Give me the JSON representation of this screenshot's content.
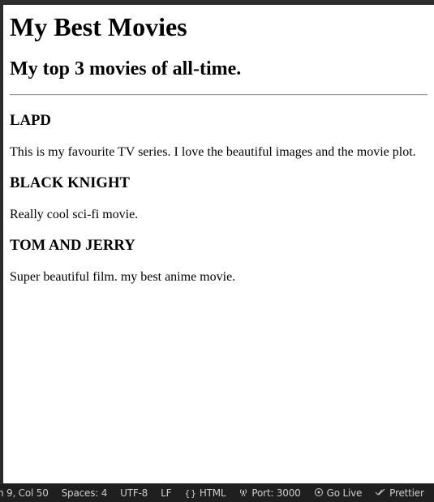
{
  "preview": {
    "title": "My Best Movies",
    "subtitle": "My top 3 movies of all-time.",
    "movies": [
      {
        "name": "LAPD",
        "description": "This is my favourite TV series. I love the beautiful images and the movie plot."
      },
      {
        "name": "BLACK KNIGHT",
        "description": "Really cool sci-fi movie."
      },
      {
        "name": "TOM AND JERRY",
        "description": "Super beautiful film. my best anime movie."
      }
    ]
  },
  "statusbar": {
    "cursor_position": "n 9, Col 50",
    "indentation": "Spaces: 4",
    "encoding": "UTF-8",
    "line_ending": "LF",
    "language": "HTML",
    "port": "Port: 3000",
    "go_live": "Go Live",
    "prettier": "Prettier",
    "icons": {
      "language": "braces-icon",
      "port": "broadcast-icon",
      "go_live": "go-live-icon",
      "prettier": "double-check-icon",
      "notifications": "bell-icon"
    }
  }
}
